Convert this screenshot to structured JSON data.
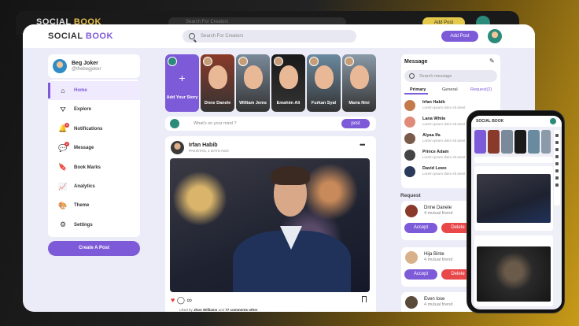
{
  "app": {
    "logo_main": "SOCIAL ",
    "logo_accent": "BOOK"
  },
  "header": {
    "search_placeholder": "Search For Creators",
    "add_post_label": "Add Post"
  },
  "profile": {
    "name": "Beg Joker",
    "handle": "@thebegjoker"
  },
  "menu": [
    {
      "label": "Home",
      "icon": "home-icon",
      "glyph": "⌂",
      "active": true
    },
    {
      "label": "Explore",
      "icon": "explore-icon",
      "glyph": "⛛"
    },
    {
      "label": "Notifications",
      "icon": "bell-icon",
      "glyph": "🔔",
      "badge": "9"
    },
    {
      "label": "Message",
      "icon": "chat-icon",
      "glyph": "💬",
      "badge": "2"
    },
    {
      "label": "Book Marks",
      "icon": "bookmark-icon",
      "glyph": "🔖"
    },
    {
      "label": "Analytics",
      "icon": "chart-icon",
      "glyph": "📈"
    },
    {
      "label": "Theme",
      "icon": "palette-icon",
      "glyph": "🎨"
    },
    {
      "label": "Settings",
      "icon": "gear-icon",
      "glyph": "⚙"
    }
  ],
  "create_post_label": "Create A Post",
  "stories": {
    "add_label": "Add Your Story",
    "items": [
      {
        "name": "Dnne Danele",
        "bg": "#8a3a2a"
      },
      {
        "name": "William Jems",
        "bg": "#7a8a9a"
      },
      {
        "name": "Emahim Ali",
        "bg": "#1a1a1a"
      },
      {
        "name": "Furkan Syal",
        "bg": "#6a8aa0"
      },
      {
        "name": "Maria Nini",
        "bg": "#8a9aa8"
      }
    ]
  },
  "composer": {
    "placeholder": "What's on your mind ?",
    "post_label": "post"
  },
  "post": {
    "author": "Irfan Habib",
    "meta": "PAKISTAN, 1 DAYS AGO",
    "liked_prefix": "Liked by ",
    "liked_user": "Jhon Williams",
    "liked_middle": " and ",
    "liked_count": "77 comments other"
  },
  "messages": {
    "title": "Message",
    "search_placeholder": "Search message",
    "tabs": [
      "Primary",
      "General",
      "Request(2)"
    ],
    "contacts": [
      {
        "name": "Irfan Habib",
        "status": "Lorem ipsum dolor sit amet",
        "color": "#c47a4a"
      },
      {
        "name": "Lana White",
        "status": "Lorem ipsum dolor sit amet",
        "color": "#e08a7a"
      },
      {
        "name": "Alyaa Ifa",
        "status": "Lorem ipsum dolor sit amet",
        "color": "#7a5a4a"
      },
      {
        "name": "Prince Adam",
        "status": "Lorem ipsum dolor sit amet",
        "color": "#444444"
      },
      {
        "name": "David Lewo",
        "status": "Lorem ipsum dolor sit amet",
        "color": "#2a3a5a"
      }
    ]
  },
  "requests": {
    "title": "Request",
    "items": [
      {
        "name": "Dnne Danele",
        "mutual": "4 mutual friend",
        "color": "#8a3a2a"
      },
      {
        "name": "Hija Binte",
        "mutual": "4 mutual friend",
        "color": "#d8b08a"
      },
      {
        "name": "Even lose",
        "mutual": "4 mutual friend",
        "color": "#5a4a3a"
      }
    ],
    "accept_label": "Accept",
    "delete_label": "Delete"
  },
  "mobile": {
    "logo": "SOCIAL BOOK"
  },
  "colors": {
    "accent": "#7d5ad8",
    "danger": "#e8484a"
  }
}
